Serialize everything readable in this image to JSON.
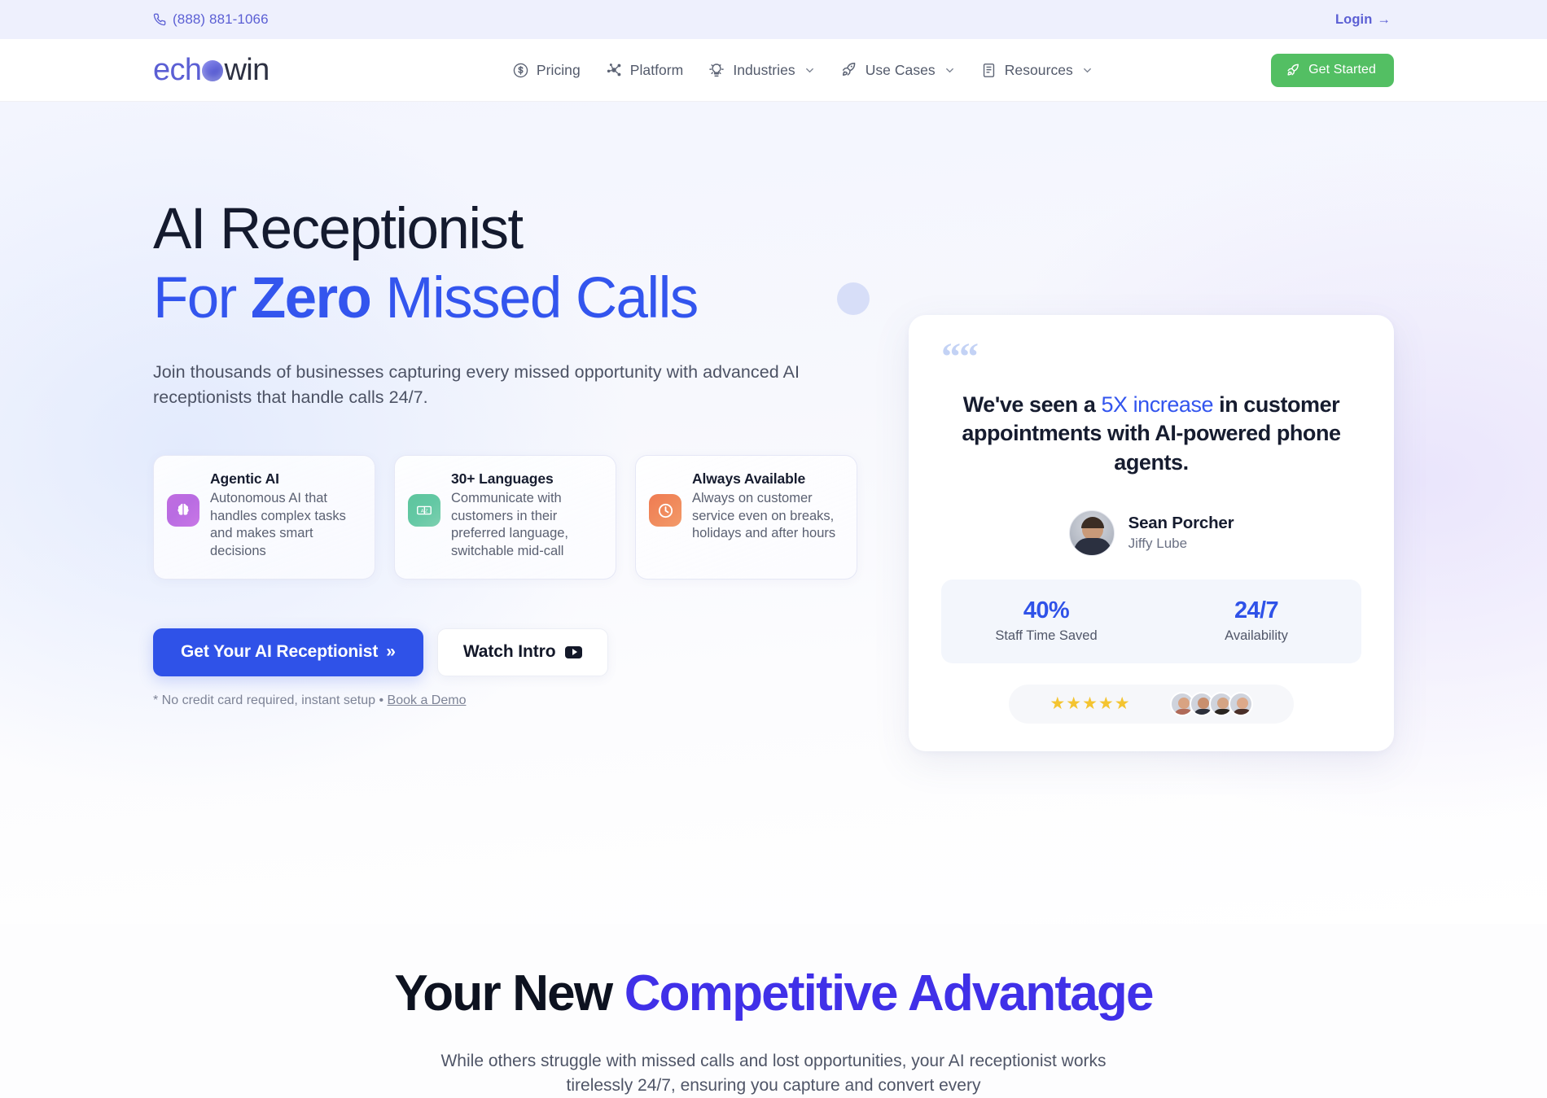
{
  "topbar": {
    "phone": "(888) 881-1066",
    "phone_icon": "phone-icon",
    "login_label": "Login",
    "login_arrow": "→"
  },
  "nav": {
    "logo": {
      "part1": "ech",
      "orb": "o",
      "part2": "win"
    },
    "items": [
      {
        "label": "Pricing",
        "icon": "dollar-circle-icon",
        "has_dropdown": false
      },
      {
        "label": "Platform",
        "icon": "network-nodes-icon",
        "has_dropdown": false
      },
      {
        "label": "Industries",
        "icon": "lightbulb-icon",
        "has_dropdown": true
      },
      {
        "label": "Use Cases",
        "icon": "rocket-icon",
        "has_dropdown": true
      },
      {
        "label": "Resources",
        "icon": "book-icon",
        "has_dropdown": true
      }
    ],
    "cta": {
      "label": "Get Started",
      "icon": "rocket-icon",
      "color": "#53bf63"
    }
  },
  "hero": {
    "headline_line1": "AI Receptionist",
    "headline_line2_pre": "For ",
    "headline_line2_bold": "Zero",
    "headline_line2_post": " Missed Calls",
    "subhead": "Join thousands of businesses capturing every missed opportunity with advanced AI receptionists that handle calls 24/7.",
    "features": [
      {
        "title": "Agentic AI",
        "desc": "Autonomous AI that handles complex tasks and makes smart decisions",
        "icon": "brain-icon",
        "icon_color": "#c06de0"
      },
      {
        "title": "30+ Languages",
        "desc": "Communicate with customers in their preferred language, switchable mid-call",
        "icon": "translate-icon",
        "icon_color": "#5ec59d"
      },
      {
        "title": "Always Available",
        "desc": "Always on customer service even on breaks, holidays and after hours",
        "icon": "clock-icon",
        "icon_color": "#ef7b52"
      }
    ],
    "primary_cta": {
      "label": "Get Your AI Receptionist",
      "chevrons": "»",
      "color": "#2f52e8"
    },
    "secondary_cta": {
      "label": "Watch Intro",
      "icon": "youtube-play-icon"
    },
    "note_prefix": "* No credit card required, instant setup • ",
    "note_link": "Book a Demo"
  },
  "testimonial": {
    "quote_mark": "“",
    "quote_pre": "We've seen a ",
    "quote_highlight": "5X increase",
    "quote_post": " in customer appointments with AI-powered phone agents.",
    "author_name": "Sean Porcher",
    "author_company": "Jiffy Lube",
    "stats": [
      {
        "value": "40%",
        "label": "Staff Time Saved"
      },
      {
        "value": "24/7",
        "label": "Availability"
      }
    ],
    "stars": "★★★★★",
    "star_count": 5,
    "avatar_count": 4
  },
  "section2": {
    "title_pre": "Your New ",
    "title_accent": "Competitive Advantage",
    "subtitle": "While others struggle with missed calls and lost opportunities, your AI receptionist works tirelessly 24/7, ensuring you capture and convert every"
  }
}
